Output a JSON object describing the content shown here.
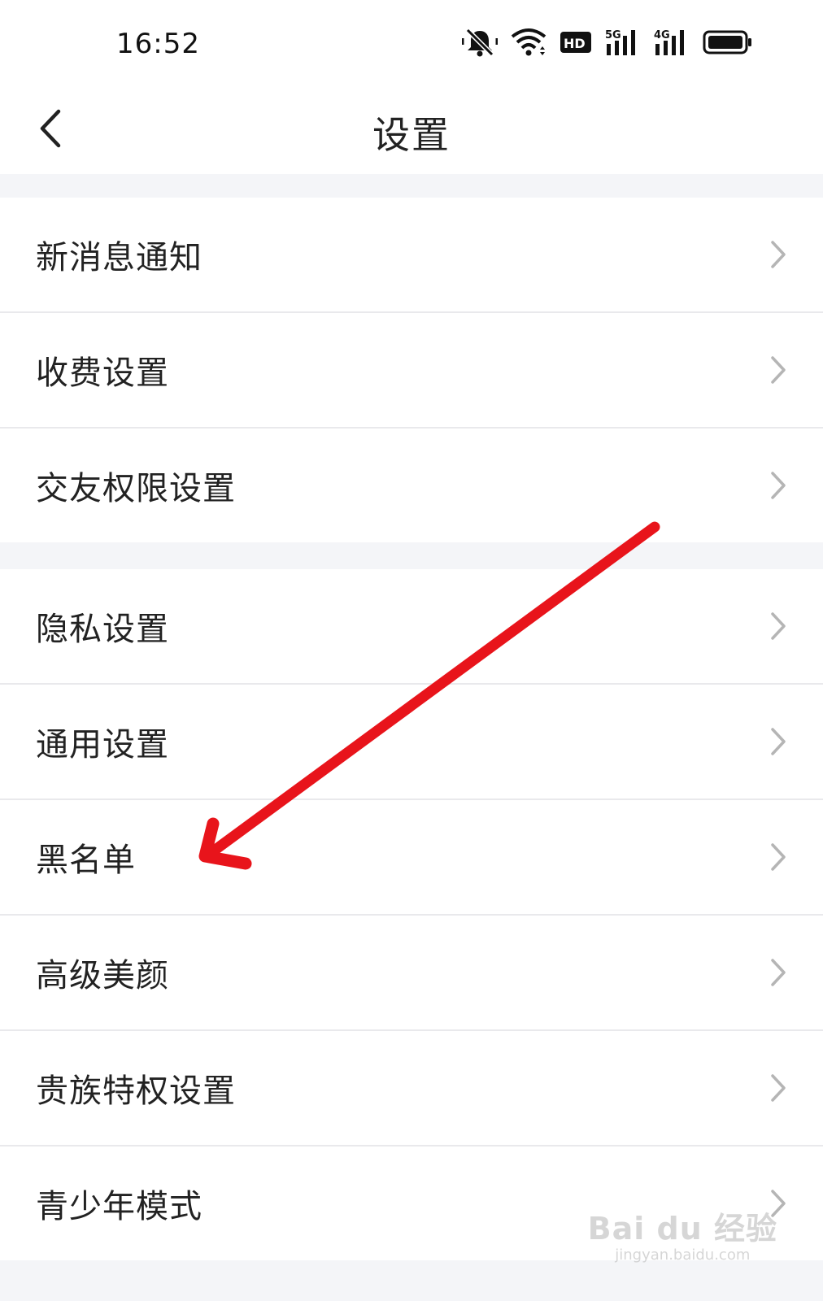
{
  "status_bar": {
    "time": "16:52",
    "icons": [
      "mute-bell-icon",
      "wifi-icon",
      "hd-icon",
      "5g-signal-icon",
      "4g-signal-icon",
      "battery-icon"
    ],
    "hd_text": "HD",
    "net1": "5G",
    "net2": "4G"
  },
  "header": {
    "title": "设置",
    "back_icon": "chevron-left-icon"
  },
  "groups": [
    {
      "items": [
        {
          "label": "新消息通知"
        },
        {
          "label": "收费设置"
        },
        {
          "label": "交友权限设置"
        }
      ]
    },
    {
      "items": [
        {
          "label": "隐私设置"
        },
        {
          "label": "通用设置"
        },
        {
          "label": "黑名单"
        },
        {
          "label": "高级美颜"
        },
        {
          "label": "贵族特权设置"
        },
        {
          "label": "青少年模式"
        }
      ]
    }
  ],
  "annotation": {
    "color": "#e8141b",
    "points_to": "黑名单"
  },
  "watermark": {
    "logo": "Bai du 经验",
    "url": "jingyan.baidu.com"
  },
  "colors": {
    "background": "#f4f5f8",
    "row_bg": "#ffffff",
    "divider": "#e9e9ec",
    "chevron": "#b5b5b5"
  }
}
